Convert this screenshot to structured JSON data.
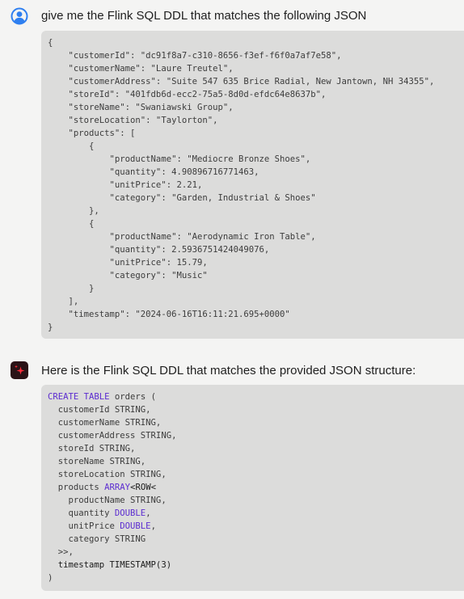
{
  "conversation": {
    "user_message": {
      "avatar_icon": "user-circle-icon",
      "text": "give me the Flink SQL DDL that matches the following JSON",
      "code_lines": [
        "{",
        "    \"customerId\": \"dc91f8a7-c310-8656-f3ef-f6f0a7af7e58\",",
        "    \"customerName\": \"Laure Treutel\",",
        "    \"customerAddress\": \"Suite 547 635 Brice Radial, New Jantown, NH 34355\",",
        "    \"storeId\": \"401fdb6d-ecc2-75a5-8d0d-efdc64e8637b\",",
        "    \"storeName\": \"Swaniawski Group\",",
        "    \"storeLocation\": \"Taylorton\",",
        "    \"products\": [",
        "        {",
        "            \"productName\": \"Mediocre Bronze Shoes\",",
        "            \"quantity\": 4.90896716771463,",
        "            \"unitPrice\": 2.21,",
        "            \"category\": \"Garden, Industrial & Shoes\"",
        "        },",
        "        {",
        "            \"productName\": \"Aerodynamic Iron Table\",",
        "            \"quantity\": 2.5936751424049076,",
        "            \"unitPrice\": 15.79,",
        "            \"category\": \"Music\"",
        "        }",
        "    ],",
        "    \"timestamp\": \"2024-06-16T16:11:21.695+0000\"",
        "}"
      ]
    },
    "assistant_message": {
      "avatar_icon": "sparkle-logo-icon",
      "text": "Here is the Flink SQL DDL that matches the provided JSON structure:",
      "code_lines": [
        [
          {
            "t": "CREATE TABLE",
            "k": true
          },
          {
            "t": " orders ("
          }
        ],
        [
          {
            "t": "  customerId STRING,"
          }
        ],
        [
          {
            "t": "  customerName STRING,"
          }
        ],
        [
          {
            "t": "  customerAddress STRING,"
          }
        ],
        [
          {
            "t": "  storeId STRING,"
          }
        ],
        [
          {
            "t": "  storeName STRING,"
          }
        ],
        [
          {
            "t": "  storeLocation STRING,"
          }
        ],
        [
          {
            "t": "  products "
          },
          {
            "t": "ARRAY",
            "k": true
          },
          {
            "t": "<ROW<",
            "d": true
          }
        ],
        [
          {
            "t": "    productName STRING,"
          }
        ],
        [
          {
            "t": "    quantity "
          },
          {
            "t": "DOUBLE",
            "k": true
          },
          {
            "t": ","
          }
        ],
        [
          {
            "t": "    unitPrice "
          },
          {
            "t": "DOUBLE",
            "k": true
          },
          {
            "t": ","
          }
        ],
        [
          {
            "t": "    category STRING"
          }
        ],
        [
          {
            "t": "  >>,"
          }
        ],
        [
          {
            "t": "  timestamp TIMESTAMP(3)",
            "d": true
          }
        ],
        [
          {
            "t": ")"
          }
        ]
      ]
    }
  },
  "colors": {
    "background": "#f4f4f3",
    "code_background": "#dcdcdb",
    "keyword": "#5b2bd0",
    "user_avatar": "#2f7ff0",
    "assistant_avatar_bg": "#2a1216",
    "assistant_avatar_star": "#ff2b3a"
  }
}
